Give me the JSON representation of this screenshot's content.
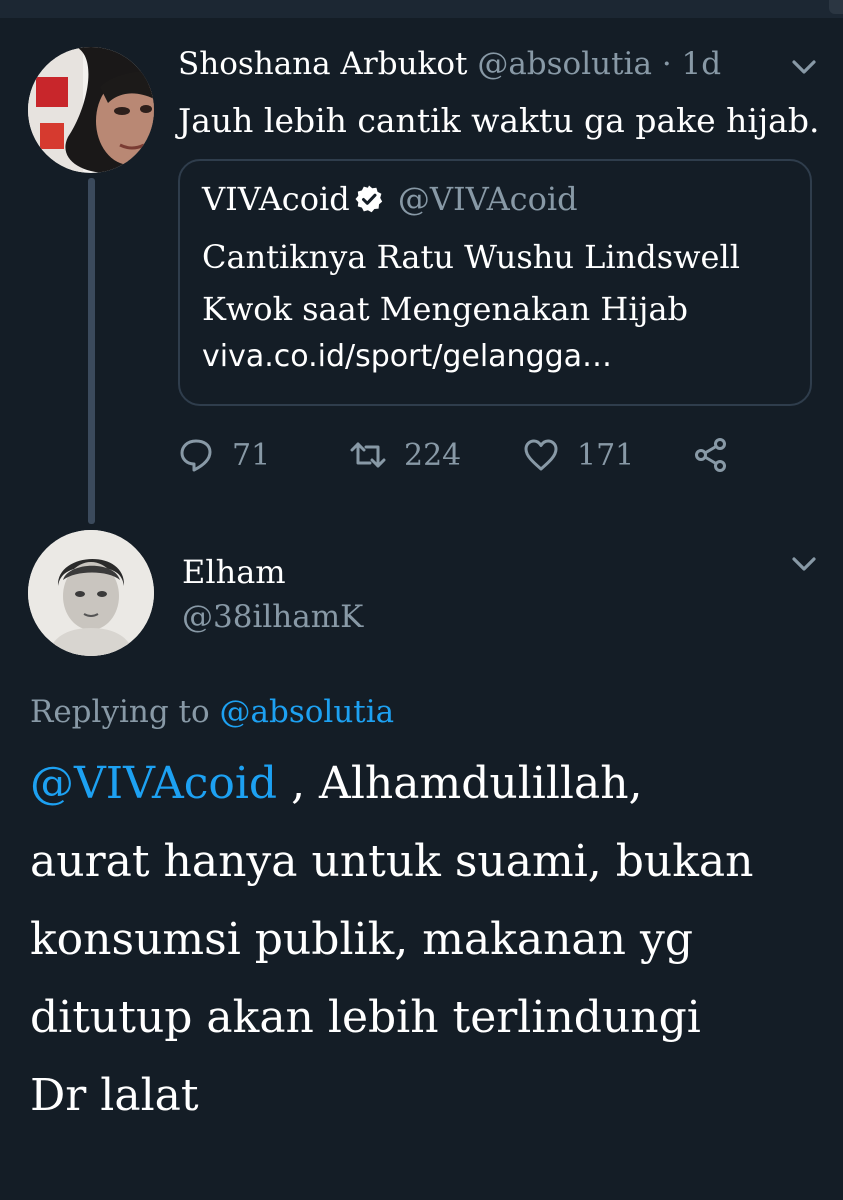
{
  "tweet1": {
    "display_name": "Shoshana Arbukot",
    "handle": "@absolutia",
    "separator": "·",
    "time": "1d",
    "text": "Jauh lebih cantik waktu ga pake hijab.",
    "quote": {
      "display_name": "VIVAcoid",
      "handle": "@VIVAcoid",
      "line1": "Cantiknya Ratu Wushu Lindswell",
      "line2": "Kwok saat Mengenakan Hijab",
      "link": "viva.co.id/sport/gelangga…"
    },
    "actions": {
      "replies": "71",
      "retweets": "224",
      "likes": "171"
    }
  },
  "tweet2": {
    "display_name": "Elham",
    "handle": "@38ilhamK",
    "replying_prefix": "Replying to",
    "replying_to": "@absolutia",
    "mention": "@VIVAcoid",
    "line1_rest": " , Alhamdulillah,",
    "line2": "aurat hanya untuk suami, bukan",
    "line3": "konsumsi publik, makanan yg",
    "line4": "ditutup akan lebih terlindungi",
    "line5": "Dr lalat"
  },
  "icons": {
    "chevron": "chevron-down-icon",
    "verified": "verified-badge-icon",
    "reply": "reply-icon",
    "retweet": "retweet-icon",
    "like": "heart-icon",
    "share": "share-icon"
  },
  "colors": {
    "background": "#141d26",
    "muted": "#8899a6",
    "link": "#1da1f2",
    "border": "#2f3d4c"
  }
}
